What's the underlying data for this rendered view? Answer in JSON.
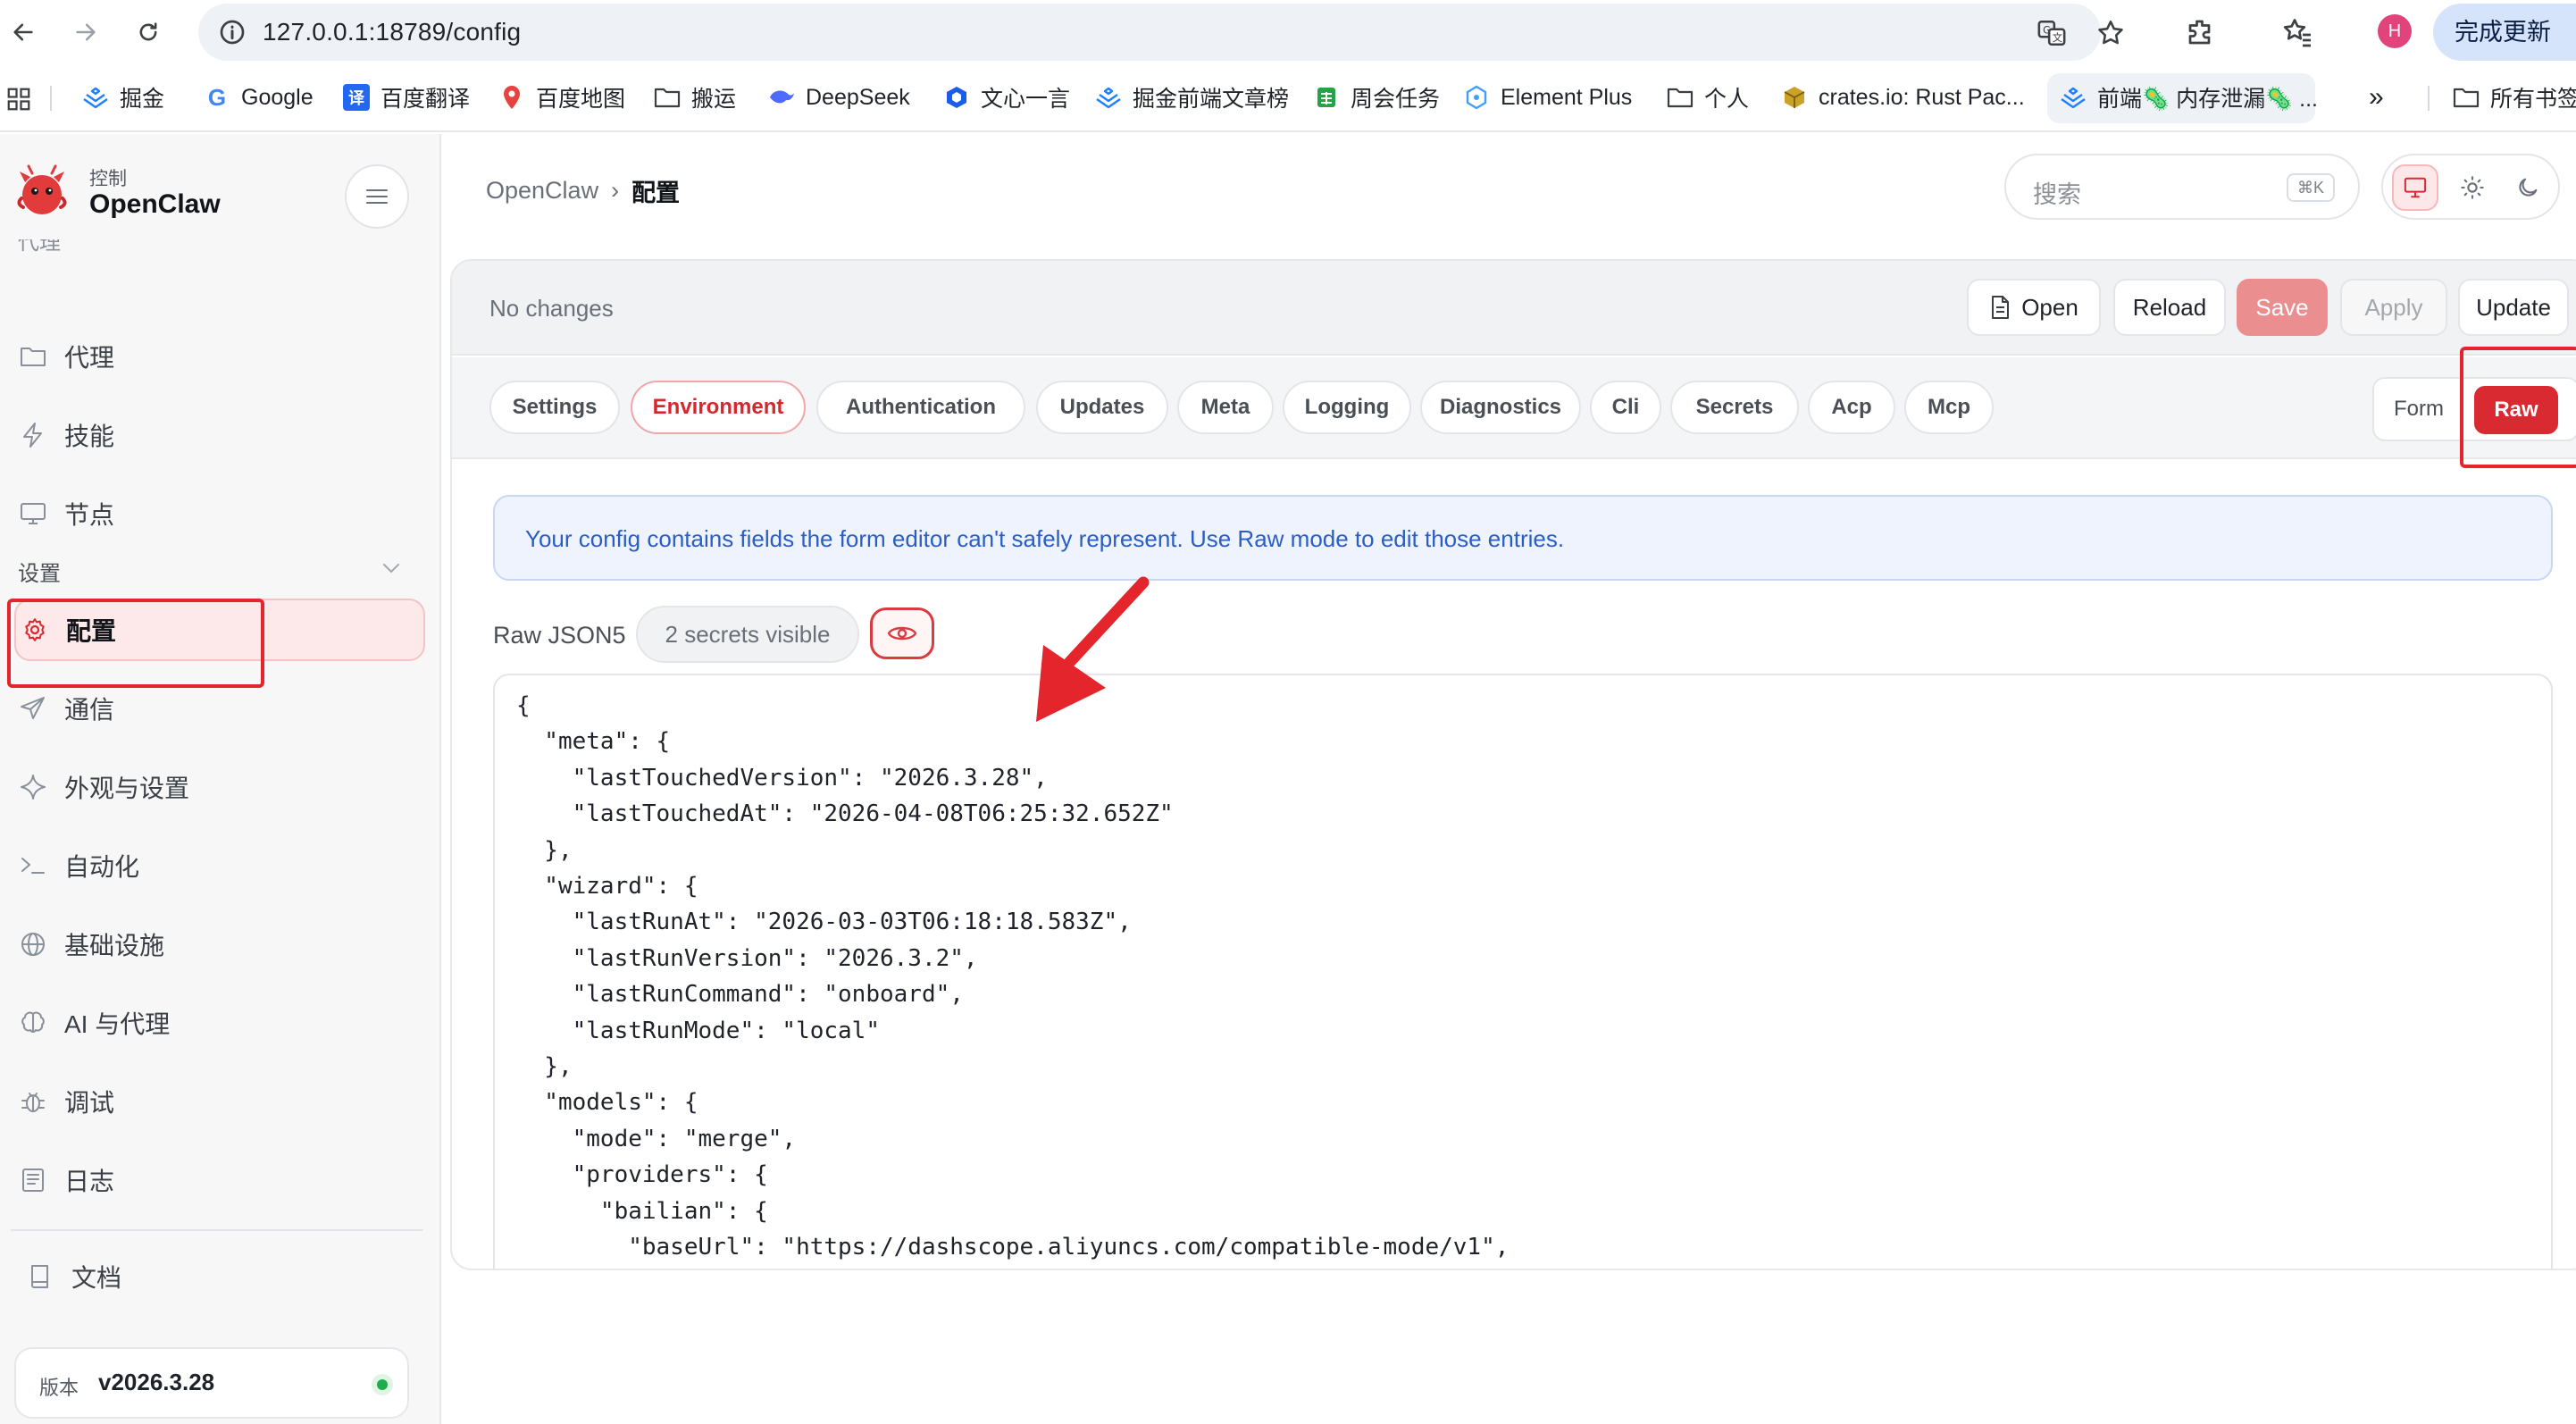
{
  "browser": {
    "url": "127.0.0.1:18789/config",
    "avatar_letter": "H",
    "update_label": "完成更新"
  },
  "bookmarks": [
    {
      "label": "掘金",
      "icon": "juejin-icon",
      "color": "#1e80ff"
    },
    {
      "label": "Google",
      "icon": "google-icon",
      "color": "#4285f4"
    },
    {
      "label": "百度翻译",
      "icon": "baidu-translate-icon",
      "color": "#2468f2"
    },
    {
      "label": "百度地图",
      "icon": "map-pin-icon",
      "color": "#e64340"
    },
    {
      "label": "搬运",
      "icon": "folder-icon",
      "color": "#3a3f45"
    },
    {
      "label": "DeepSeek",
      "icon": "deepseek-icon",
      "color": "#4d6bfe"
    },
    {
      "label": "文心一言",
      "icon": "wenxin-icon",
      "color": "#1a5de8"
    },
    {
      "label": "掘金前端文章榜",
      "icon": "juejin-icon",
      "color": "#1e80ff"
    },
    {
      "label": "周会任务",
      "icon": "sheet-icon",
      "color": "#22a447"
    },
    {
      "label": "Element Plus",
      "icon": "element-plus-icon",
      "color": "#409eff"
    },
    {
      "label": "个人",
      "icon": "folder-icon",
      "color": "#3a3f45"
    },
    {
      "label": "crates.io: Rust Pac...",
      "icon": "crates-icon",
      "color": "#c9a227"
    },
    {
      "label": "前端🦠 内存泄漏🦠 ...",
      "icon": "juejin-icon",
      "color": "#1e80ff"
    },
    {
      "label": "所有书签",
      "icon": "folder-icon",
      "color": "#3a3f45"
    }
  ],
  "sidebar": {
    "brand_small": "控制",
    "brand_name": "OpenClaw",
    "cut_label": "代理",
    "items": [
      {
        "label": "代理",
        "icon": "folder-icon"
      },
      {
        "label": "技能",
        "icon": "bolt-icon"
      },
      {
        "label": "节点",
        "icon": "monitor-icon"
      }
    ],
    "section_label": "设置",
    "settings_items": [
      {
        "label": "配置",
        "icon": "gear-icon"
      },
      {
        "label": "通信",
        "icon": "send-icon"
      },
      {
        "label": "外观与设置",
        "icon": "sparkle-icon"
      },
      {
        "label": "自动化",
        "icon": "terminal-icon"
      },
      {
        "label": "基础设施",
        "icon": "globe-icon"
      },
      {
        "label": "AI 与代理",
        "icon": "brain-icon"
      },
      {
        "label": "调试",
        "icon": "bug-icon"
      },
      {
        "label": "日志",
        "icon": "log-icon"
      }
    ],
    "docs_label": "文档",
    "version_label": "版本",
    "version_value": "v2026.3.28"
  },
  "header": {
    "breadcrumb_root": "OpenClaw",
    "breadcrumb_sep": "›",
    "breadcrumb_current": "配置",
    "search_placeholder": "搜索",
    "search_shortcut": "⌘K"
  },
  "toolbar": {
    "status": "No changes",
    "open_label": "Open",
    "reload_label": "Reload",
    "save_label": "Save",
    "apply_label": "Apply",
    "update_label": "Update"
  },
  "tabs": [
    "Settings",
    "Environment",
    "Authentication",
    "Updates",
    "Meta",
    "Logging",
    "Diagnostics",
    "Cli",
    "Secrets",
    "Acp",
    "Mcp"
  ],
  "active_tab": "Environment",
  "mode": {
    "form_label": "Form",
    "raw_label": "Raw"
  },
  "banner_text": "Your config contains fields the form editor can't safely represent. Use Raw mode to edit those entries.",
  "raw": {
    "label": "Raw JSON5",
    "secrets": "2 secrets visible",
    "code": "{\n  \"meta\": {\n    \"lastTouchedVersion\": \"2026.3.28\",\n    \"lastTouchedAt\": \"2026-04-08T06:25:32.652Z\"\n  },\n  \"wizard\": {\n    \"lastRunAt\": \"2026-03-03T06:18:18.583Z\",\n    \"lastRunVersion\": \"2026.3.2\",\n    \"lastRunCommand\": \"onboard\",\n    \"lastRunMode\": \"local\"\n  },\n  \"models\": {\n    \"mode\": \"merge\",\n    \"providers\": {\n      \"bailian\": {\n        \"baseUrl\": \"https://dashscope.aliyuncs.com/compatible-mode/v1\","
  },
  "colors": {
    "accent": "#d92a31",
    "annotation": "#e5252c",
    "info": "#2a5ec4",
    "status_ok": "#1fae4b"
  }
}
